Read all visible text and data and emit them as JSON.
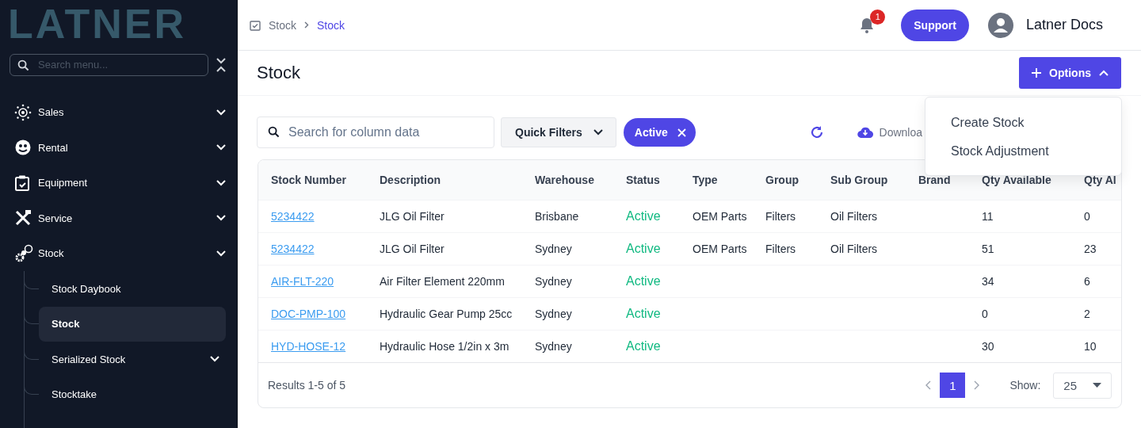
{
  "logo": {
    "text": "LATNER"
  },
  "sidebar": {
    "search": {
      "placeholder": "Search menu..."
    },
    "items": [
      {
        "label": "Sales",
        "expanded": false
      },
      {
        "label": "Rental",
        "expanded": false
      },
      {
        "label": "Equipment",
        "expanded": false
      },
      {
        "label": "Service",
        "expanded": false
      },
      {
        "label": "Stock",
        "expanded": true,
        "children": [
          {
            "label": "Stock Daybook",
            "selected": false,
            "has_submenu": false
          },
          {
            "label": "Stock",
            "selected": true,
            "has_submenu": false
          },
          {
            "label": "Serialized Stock",
            "selected": false,
            "has_submenu": true
          },
          {
            "label": "Stocktake",
            "selected": false,
            "has_submenu": false
          }
        ]
      }
    ]
  },
  "breadcrumb": [
    "Stock",
    "Stock"
  ],
  "header": {
    "notification_count": "1",
    "support_button": "Support",
    "user_name": "Latner Docs"
  },
  "page_title": "Stock",
  "options_button": {
    "label": "Options",
    "expanded": true,
    "menu": [
      "Create Stock",
      "Stock Adjustment"
    ]
  },
  "toolbar": {
    "search": {
      "placeholder": "Search for column data"
    },
    "quick_filters": "Quick Filters",
    "filter_chip": "Active",
    "download": "Downloa"
  },
  "table": {
    "columns": [
      "Stock Number",
      "Description",
      "Warehouse",
      "Status",
      "Type",
      "Group",
      "Sub Group",
      "Brand",
      "Qty Available",
      "Qty Al"
    ],
    "rows": [
      [
        "5234422",
        "JLG Oil Filter",
        "Brisbane",
        "Active",
        "OEM Parts",
        "Filters",
        "Oil Filters",
        null,
        "11",
        "0"
      ],
      [
        "5234422",
        "JLG Oil Filter",
        "Sydney",
        "Active",
        "OEM Parts",
        "Filters",
        "Oil Filters",
        null,
        "51",
        "23"
      ],
      [
        "AIR-FLT-220",
        "Air Filter Element 220mm",
        "Sydney",
        "Active",
        null,
        null,
        null,
        null,
        "34",
        "6"
      ],
      [
        "DOC-PMP-100",
        "Hydraulic Gear Pump 25cc",
        "Sydney",
        "Active",
        null,
        null,
        null,
        null,
        "0",
        "2"
      ],
      [
        "HYD-HOSE-12",
        "Hydraulic Hose 1/2in x 3m",
        "Sydney",
        "Active",
        null,
        null,
        null,
        null,
        "30",
        "10"
      ]
    ]
  },
  "footer": {
    "results": "Results 1-5 of 5",
    "pages": [
      {
        "label": "1",
        "selected": true
      }
    ],
    "show_label": "Show:",
    "page_size": "25"
  }
}
